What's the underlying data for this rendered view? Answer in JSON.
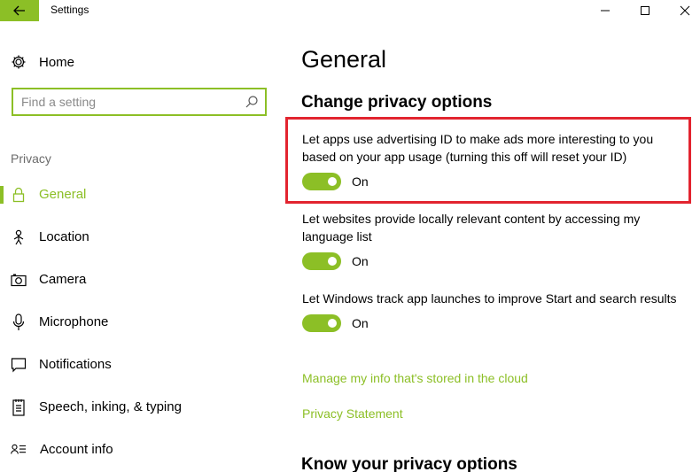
{
  "window": {
    "title": "Settings",
    "accent_color": "#8cbf26",
    "highlight_color": "#e2242f"
  },
  "sidebar": {
    "home_label": "Home",
    "search_placeholder": "Find a setting",
    "section_label": "Privacy",
    "items": [
      {
        "label": "General",
        "icon": "lock-icon",
        "active": true
      },
      {
        "label": "Location",
        "icon": "location-person-icon",
        "active": false
      },
      {
        "label": "Camera",
        "icon": "camera-icon",
        "active": false
      },
      {
        "label": "Microphone",
        "icon": "microphone-icon",
        "active": false
      },
      {
        "label": "Notifications",
        "icon": "notifications-icon",
        "active": false
      },
      {
        "label": "Speech, inking, & typing",
        "icon": "speech-icon",
        "active": false
      },
      {
        "label": "Account info",
        "icon": "account-info-icon",
        "active": false
      }
    ]
  },
  "main": {
    "title": "General",
    "section_title": "Change privacy options",
    "settings": [
      {
        "description": "Let apps use advertising ID to make ads more interesting to you based on your app usage (turning this off will reset your ID)",
        "state": "On",
        "highlighted": true
      },
      {
        "description": "Let websites provide locally relevant content by accessing my language list",
        "state": "On",
        "highlighted": false
      },
      {
        "description": "Let Windows track app launches to improve Start and search results",
        "state": "On",
        "highlighted": false
      }
    ],
    "links": {
      "manage_info": "Manage my info that's stored in the cloud",
      "privacy_statement": "Privacy Statement"
    },
    "section_title_2": "Know your privacy options"
  }
}
